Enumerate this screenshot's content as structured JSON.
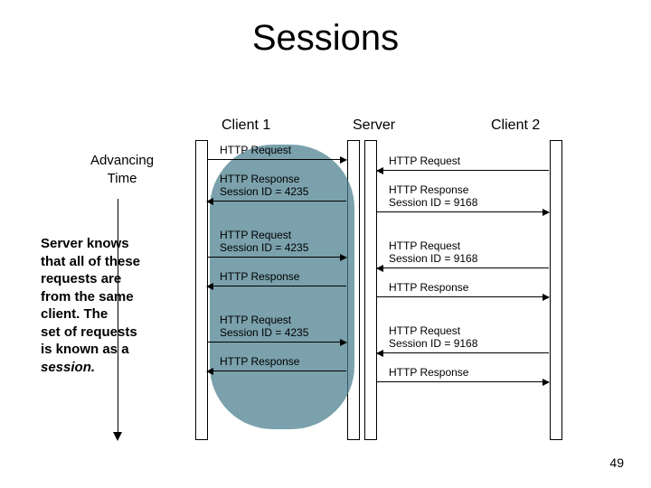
{
  "title": "Sessions",
  "page_number": "49",
  "headers": {
    "client1": "Client 1",
    "server": "Server",
    "client2": "Client 2"
  },
  "advancing_time": {
    "line1": "Advancing",
    "line2": "Time"
  },
  "caption": {
    "line1": "Server knows",
    "line2": "that all of these",
    "line3": "requests are",
    "line4": "from the same",
    "line5": "client.  The",
    "line6": "set of requests",
    "line7": "is known as a",
    "line8_italic": "session."
  },
  "left": {
    "m1": "HTTP Request",
    "m2a": "HTTP Response",
    "m2b": "Session ID = 4235",
    "m3a": "HTTP Request",
    "m3b": "Session ID = 4235",
    "m4": "HTTP Response",
    "m5a": "HTTP Request",
    "m5b": "Session ID = 4235",
    "m6": "HTTP Response"
  },
  "right": {
    "m1": "HTTP Request",
    "m2a": "HTTP Response",
    "m2b": "Session ID = 9168",
    "m3a": "HTTP Request",
    "m3b": "Session ID = 9168",
    "m4": "HTTP Response",
    "m5a": "HTTP Request",
    "m5b": "Session ID = 9168",
    "m6": "HTTP Response"
  }
}
